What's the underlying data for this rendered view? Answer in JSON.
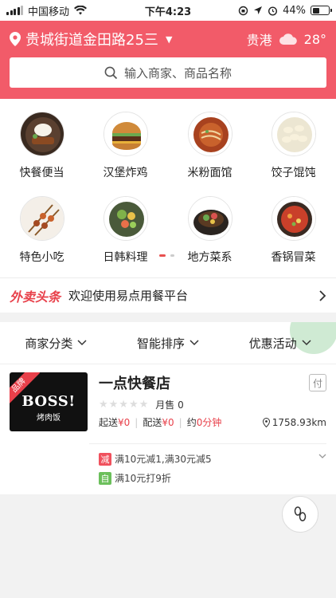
{
  "status": {
    "carrier": "中国移动",
    "time": "下午4:23",
    "battery": "44%",
    "battery_level": 0.44
  },
  "header": {
    "location": "贵城街道金田路25三",
    "city": "贵港",
    "temperature": "28°",
    "search_placeholder": "输入商家、商品名称"
  },
  "categories": [
    {
      "label": "快餐便当",
      "icon": "rice-plate-icon"
    },
    {
      "label": "汉堡炸鸡",
      "icon": "burger-icon"
    },
    {
      "label": "米粉面馆",
      "icon": "noodle-icon"
    },
    {
      "label": "饺子馄饨",
      "icon": "dumpling-icon"
    },
    {
      "label": "特色小吃",
      "icon": "skewer-icon"
    },
    {
      "label": "日韩料理",
      "icon": "salad-icon"
    },
    {
      "label": "地方菜系",
      "icon": "hotpot-icon"
    },
    {
      "label": "香锅冒菜",
      "icon": "spicy-pot-icon"
    }
  ],
  "headline": {
    "logo": "外卖头条",
    "text": "欢迎使用易点用餐平台"
  },
  "filters": {
    "category": "商家分类",
    "sort": "智能排序",
    "promo": "优惠活动"
  },
  "restaurant": {
    "badge": "品牌",
    "logo_title": "BOSS!",
    "logo_sub": "烤肉饭",
    "name": "一点快餐店",
    "pay_badge": "付",
    "stars": "★★★★★",
    "monthly_sales": "月售 0",
    "min_order_label": "起送",
    "min_order_value": "¥0",
    "delivery_label": "配送",
    "delivery_value": "¥0",
    "time_label": "约",
    "time_value": "0分钟",
    "distance": "1758.93km",
    "promotions": [
      {
        "tag": "减",
        "color": "#f0515d",
        "text": "满10元减1,满30元减5"
      },
      {
        "tag": "自",
        "color": "#6bbf5b",
        "text": "满10元打9折"
      }
    ]
  }
}
